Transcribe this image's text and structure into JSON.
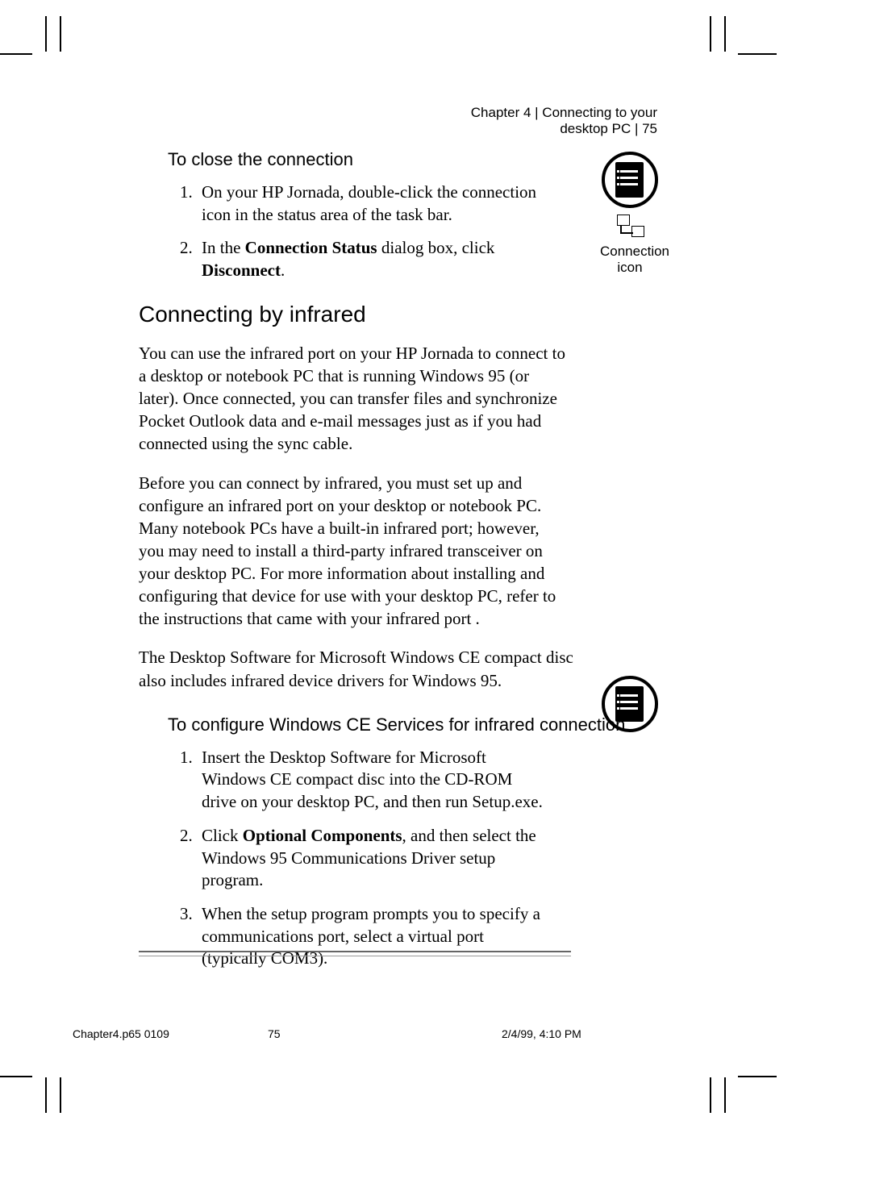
{
  "header": {
    "text": "Chapter 4 | Connecting to your desktop PC | 75"
  },
  "sections": {
    "close": {
      "heading": "To close the connection",
      "step1_a": "On your HP Jornada, double-click the connection icon in the status area of the task bar.",
      "step2_a": "In the ",
      "step2_bold1": "Connection Status",
      "step2_b": " dialog box, click ",
      "step2_bold2": "Disconnect",
      "step2_c": "."
    },
    "infrared": {
      "title": "Connecting by infrared",
      "p1": "You can use the infrared port on your HP Jornada to connect to a desktop or notebook PC that is running Windows 95 (or later). Once connected, you can transfer files and synchronize Pocket Outlook data and e-mail messages just as if you had connected using the sync cable.",
      "p2": "Before you can connect by infrared, you must set up and configure an infrared port on your desktop or notebook PC. Many notebook PCs have a built-in infrared port; however, you may need to install a third-party infrared transceiver on your desktop PC. For more information about installing and configuring that device for use with your desktop PC, refer to the instructions that came with your infrared port .",
      "p3": "The Desktop Software for Microsoft Windows CE compact disc also includes infrared device drivers for Windows 95."
    },
    "configure": {
      "heading": "To configure Windows CE Services for infrared connection",
      "step1": "Insert the Desktop Software for Microsoft Windows CE compact disc into the CD-ROM drive on your desktop PC, and then run Setup.exe.",
      "step2_a": "Click ",
      "step2_bold": "Optional Components",
      "step2_b": ", and then select the Windows 95 Communications Driver setup program.",
      "step3": "When the setup program prompts you to specify a communications port, select a virtual port (typically COM3)."
    }
  },
  "sidebar": {
    "connection_label_1": "Connection",
    "connection_label_2": "icon"
  },
  "footer": {
    "file": "Chapter4.p65 0109",
    "page": "75",
    "datetime": "2/4/99, 4:10 PM"
  }
}
